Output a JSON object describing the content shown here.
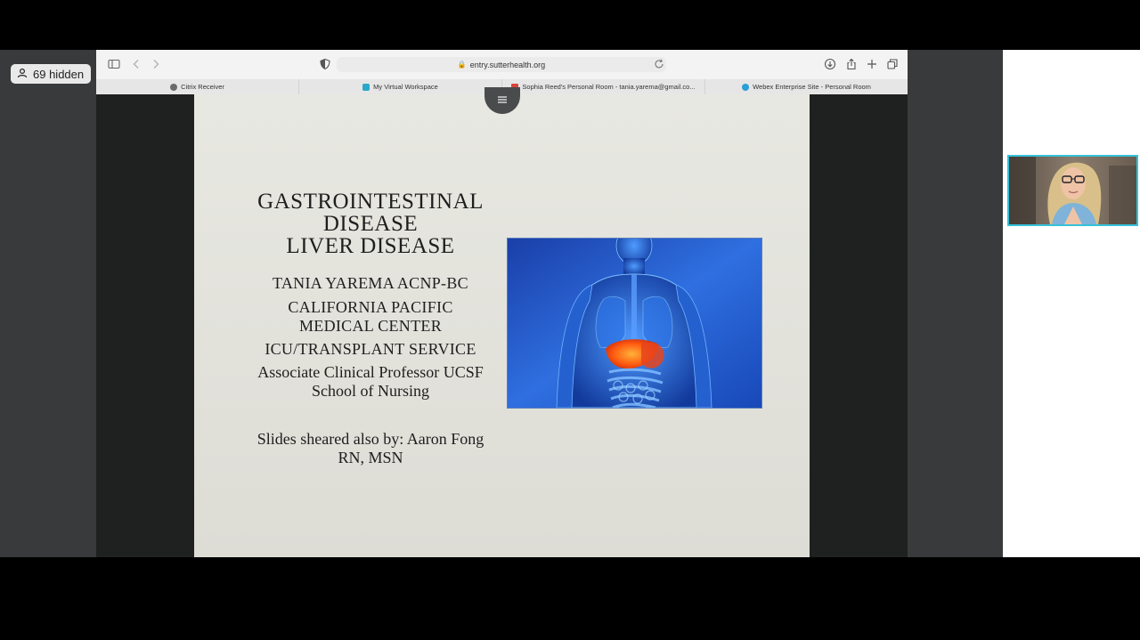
{
  "participants": {
    "hidden_label": "69 hidden"
  },
  "browser": {
    "url": "entry.sutterhealth.org",
    "tabs": [
      {
        "label": "Citrix Receiver",
        "icon": "citrix-icon"
      },
      {
        "label": "My Virtual Workspace",
        "icon": "workspace-icon"
      },
      {
        "label": "Sophia Reed's Personal Room - tania.yarema@gmail.co...",
        "icon": "gmail-icon"
      },
      {
        "label": "Webex Enterprise Site - Personal Room",
        "icon": "webex-icon"
      }
    ]
  },
  "slide": {
    "title_lines": [
      "GASTROINTESTINAL",
      "DISEASE",
      "LIVER DISEASE"
    ],
    "presenter": "TANIA YAREMA ACNP-BC",
    "org_lines": [
      "CALIFORNIA PACIFIC",
      "MEDICAL CENTER"
    ],
    "service": "ICU/TRANSPLANT SERVICE",
    "professor_lines": [
      "Associate Clinical Professor UCSF",
      "School of Nursing"
    ],
    "credit_lines": [
      "Slides sheared also by: Aaron Fong",
      "RN, MSN"
    ],
    "image": "digestive-system-illustration"
  },
  "colors": {
    "video_border": "#36c1d9",
    "slide_bg": "#e4e3dd",
    "anatomy_blue": "#1f5bc4",
    "liver": "#ff6a1a"
  }
}
